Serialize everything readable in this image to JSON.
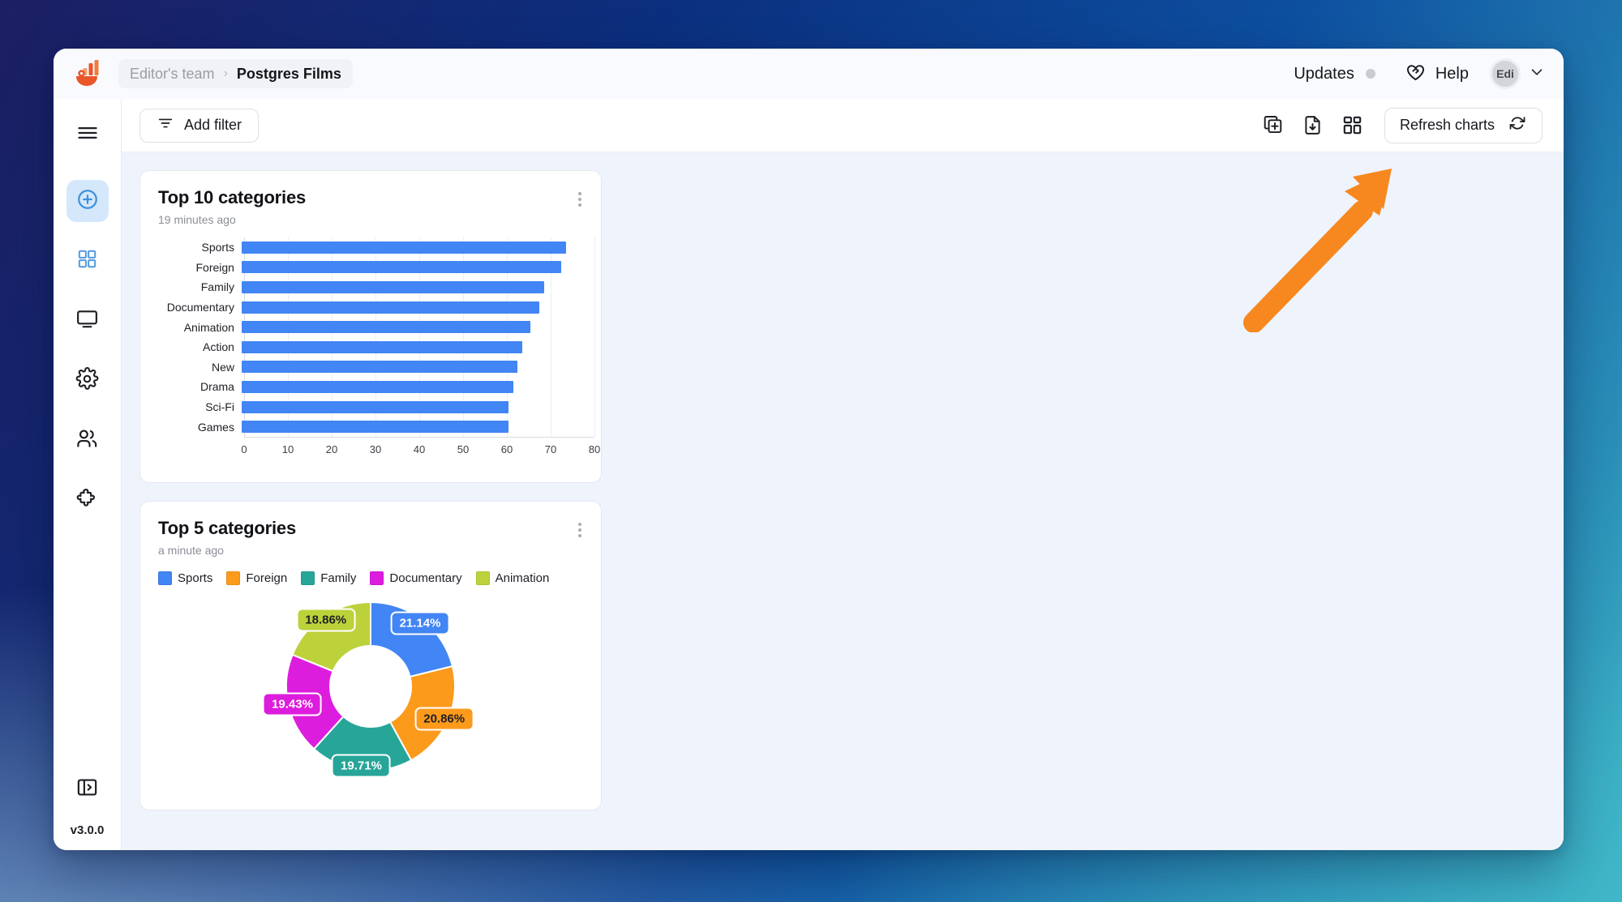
{
  "window": {
    "background_gradient_from": "#1c1f63",
    "background_gradient_to": "#41b9c9"
  },
  "topbar": {
    "logo_icon": "metabase-cup-chart-logo",
    "breadcrumb": {
      "team": "Editor's team",
      "separator": "›",
      "current": "Postgres Films"
    },
    "updates_label": "Updates",
    "updates_dot_color": "#c9cbd2",
    "help_label": "Help",
    "help_icon": "heart-hands-icon",
    "avatar_initials": "Edi",
    "chevron_icon": "chevron-down-icon"
  },
  "sidebar": {
    "items": [
      {
        "name": "hamburger-menu",
        "icon": "hamburger-icon",
        "active": false
      },
      {
        "name": "new-question",
        "icon": "plus-circle-icon",
        "active": true
      },
      {
        "name": "dashboards",
        "icon": "grid-squares-icon",
        "active": false
      },
      {
        "name": "screens",
        "icon": "monitor-icon",
        "active": false
      },
      {
        "name": "settings",
        "icon": "gear-icon",
        "active": false
      },
      {
        "name": "people",
        "icon": "users-icon",
        "active": false
      },
      {
        "name": "plugins",
        "icon": "puzzle-icon",
        "active": false
      }
    ],
    "collapse_icon": "panel-expand-icon",
    "version": "v3.0.0"
  },
  "toolbar": {
    "add_filter_label": "Add filter",
    "add_filter_icon": "filter-icon",
    "icons": [
      {
        "name": "duplicate-add-icon",
        "label": "Add card"
      },
      {
        "name": "file-download-icon",
        "label": "Export"
      },
      {
        "name": "layout-grid-icon",
        "label": "Change layout"
      }
    ],
    "refresh_label": "Refresh charts",
    "refresh_icon": "refresh-icon"
  },
  "cards": [
    {
      "title": "Top 10 categories",
      "subtitle": "19 minutes ago",
      "menu_icon": "kebab-menu-icon"
    },
    {
      "title": "Top 5 categories",
      "subtitle": "a minute ago",
      "menu_icon": "kebab-menu-icon"
    }
  ],
  "annotation": {
    "arrow_color": "#f7881f",
    "points_to": "layout-grid-icon"
  },
  "chart_data": [
    {
      "type": "bar",
      "title": "Top 10 categories",
      "orientation": "horizontal",
      "categories": [
        "Sports",
        "Foreign",
        "Family",
        "Documentary",
        "Animation",
        "Action",
        "New",
        "Drama",
        "Sci-Fi",
        "Games"
      ],
      "values": [
        74,
        73,
        69,
        68,
        66,
        64,
        63,
        62,
        61,
        61
      ],
      "xlabel": "",
      "ylabel": "",
      "xlim": [
        0,
        80
      ],
      "xticks": [
        0,
        10,
        20,
        30,
        40,
        50,
        60,
        70,
        80
      ],
      "grid": true,
      "bar_color": "#4285f4",
      "legend": false
    },
    {
      "type": "pie",
      "subtype": "donut",
      "title": "Top 5 categories",
      "labels": [
        "Sports",
        "Foreign",
        "Family",
        "Documentary",
        "Animation"
      ],
      "values": [
        21.14,
        20.86,
        19.71,
        19.43,
        18.86
      ],
      "value_labels": [
        "21.14%",
        "20.86%",
        "19.71%",
        "19.43%",
        "18.86%"
      ],
      "colors": [
        "#4285f4",
        "#fb9a1b",
        "#27a598",
        "#dd1ddd",
        "#bdd13a"
      ],
      "label_text_colors": [
        "#ffffff",
        "#1d1f24",
        "#ffffff",
        "#ffffff",
        "#1d1f24"
      ],
      "legend_position": "top",
      "start_angle_deg": 0,
      "direction": "clockwise"
    }
  ]
}
